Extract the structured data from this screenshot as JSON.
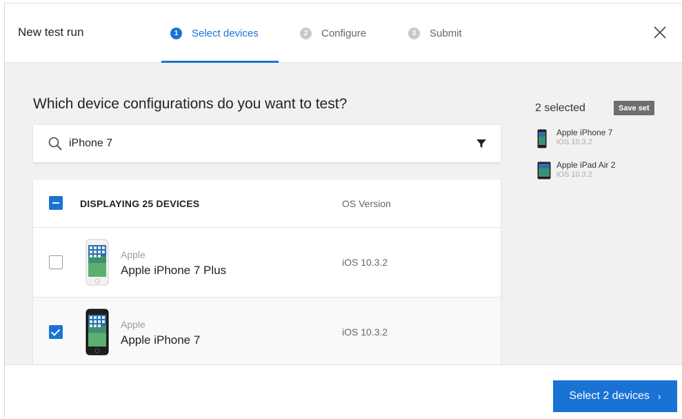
{
  "header": {
    "title": "New test run",
    "steps": [
      {
        "number": "1",
        "label": "Select devices",
        "state": "active"
      },
      {
        "number": "2",
        "label": "Configure",
        "state": "inactive"
      },
      {
        "number": "3",
        "label": "Submit",
        "state": "inactive"
      }
    ],
    "close_icon": "close-icon"
  },
  "main": {
    "question": "Which device configurations do you want to test?",
    "search": {
      "value": "iPhone 7",
      "icon": "search-icon",
      "filter_icon": "filter-icon"
    },
    "table": {
      "header_label": "DISPLAYING 25 DEVICES",
      "os_header": "OS Version",
      "rows": [
        {
          "brand": "Apple",
          "name": "Apple iPhone 7 Plus",
          "os": "iOS 10.3.2",
          "checked": false
        },
        {
          "brand": "Apple",
          "name": "Apple iPhone 7",
          "os": "iOS 10.3.2",
          "checked": true
        }
      ]
    }
  },
  "selection": {
    "count_label": "2 selected",
    "save_set_label": "Save set",
    "items": [
      {
        "name": "Apple iPhone 7",
        "os": "iOS 10.3.2"
      },
      {
        "name": "Apple iPad Air 2",
        "os": "iOS 10.3.2"
      }
    ]
  },
  "footer": {
    "primary_label": "Select 2 devices",
    "primary_chevron": "›"
  },
  "colors": {
    "accent": "#1a73d4",
    "inactive_step": "#c9c9c9",
    "save_set_bg": "#6e6e6e"
  }
}
